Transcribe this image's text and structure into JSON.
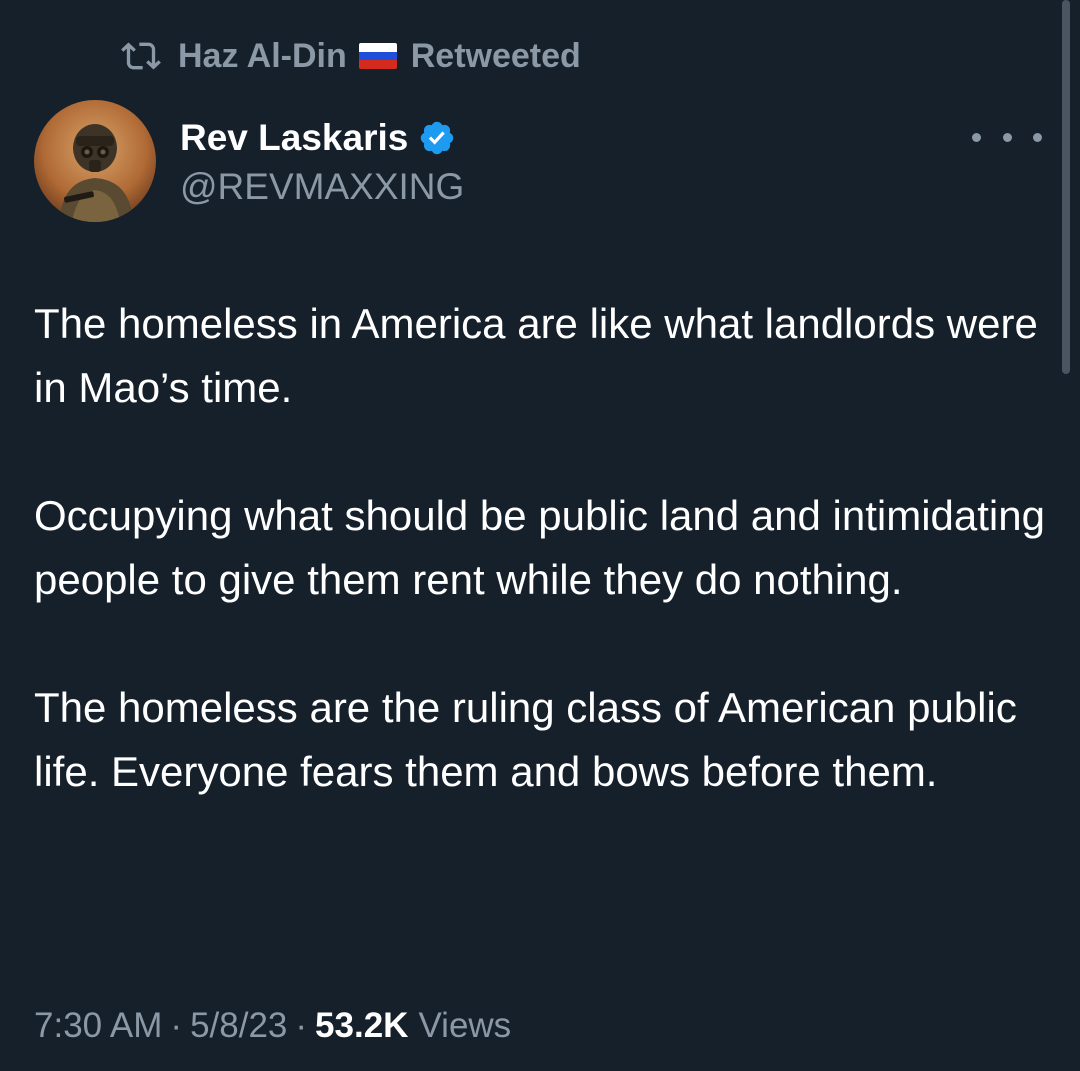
{
  "retweet": {
    "icon": "retweet-icon",
    "retweeter_name": "Haz Al-Din",
    "flag": "russia-flag",
    "label": "Retweeted"
  },
  "author": {
    "display_name": "Rev Laskaris",
    "handle": "@REVMAXXING",
    "verified": true
  },
  "tweet": {
    "text": "The homeless in America are like what landlords were in Mao’s time.\n\nOccupying what should be public land and intimidating people to give them rent while they do nothing.\n\nThe homeless are the ruling class of American public life. Everyone fears them and bows before them."
  },
  "meta": {
    "time": "7:30 AM",
    "separator": "·",
    "date": "5/8/23",
    "views_count": "53.2K",
    "views_label": "Views"
  },
  "colors": {
    "background": "#15202b",
    "text": "#ffffff",
    "secondary": "#8b98a5",
    "verified": "#1d9bf0"
  }
}
